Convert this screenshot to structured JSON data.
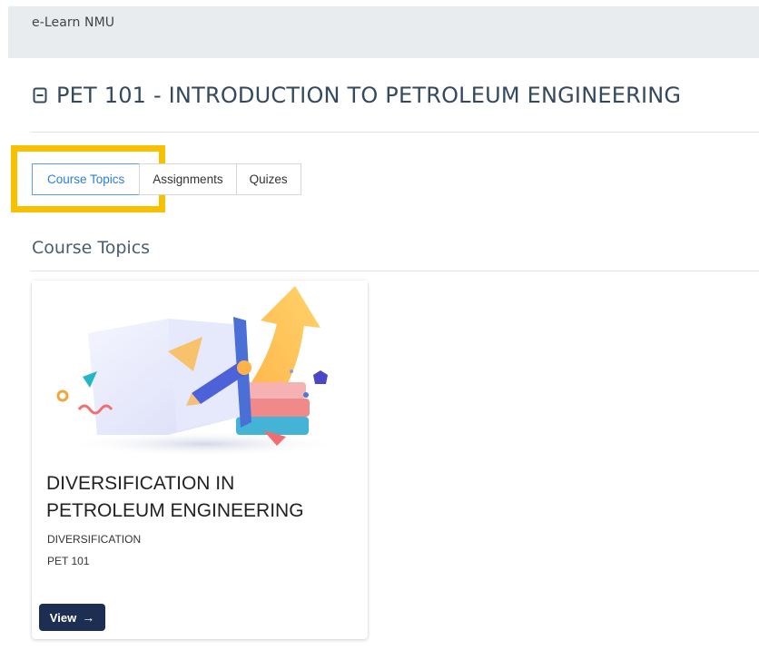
{
  "header": {
    "brand": "e-Learn NMU"
  },
  "course": {
    "title": "PET 101 - INTRODUCTION TO PETROLEUM ENGINEERING"
  },
  "tabs": [
    {
      "label": "Course Topics",
      "active": true
    },
    {
      "label": "Assignments",
      "active": false
    },
    {
      "label": "Quizes",
      "active": false
    }
  ],
  "section": {
    "heading": "Course Topics"
  },
  "topics": [
    {
      "title": "DIVERSIFICATION IN PETROLEUM ENGINEERING",
      "subtitle": "DIVERSIFICATION",
      "code": "PET 101",
      "view_label": "View",
      "image": "book-with-arrow-illustration"
    }
  ],
  "colors": {
    "highlight": "#f7c000",
    "active_tab": "#2a7fd6",
    "view_button": "#1c2e52",
    "topbar": "#e9ecef"
  }
}
